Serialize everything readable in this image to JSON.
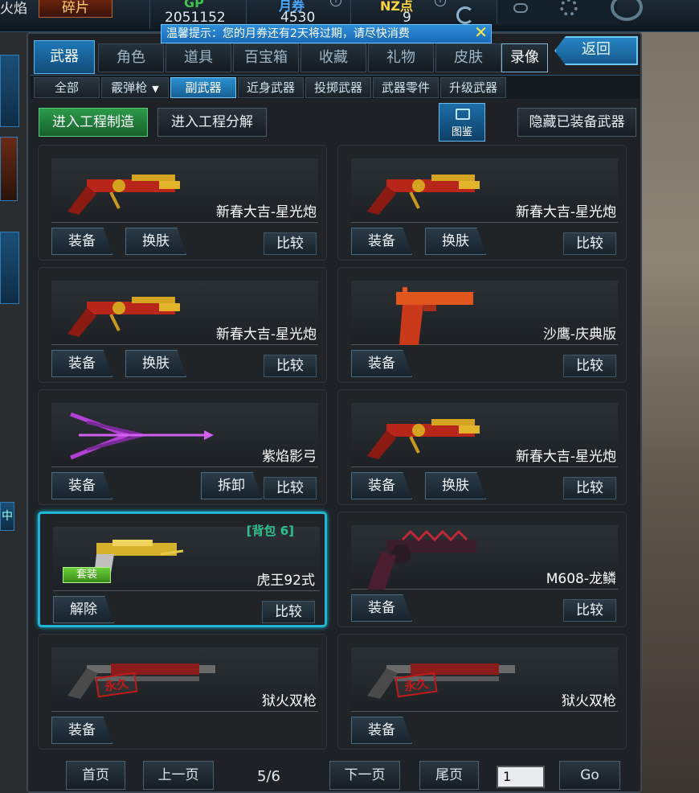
{
  "topbar": {
    "left_text": "火焰",
    "fragment_label": "碎片",
    "gp_label": "GP",
    "gp_value": "2051152",
    "voucher_label": "月券",
    "voucher_value": "4530",
    "nz_label": "NZ点",
    "nz_value": "9"
  },
  "notice": {
    "text": "温馨提示：您的月券还有2天将过期，请尽快消费",
    "close": "✕"
  },
  "tabs": [
    {
      "label": "武器",
      "active": true
    },
    {
      "label": "角色"
    },
    {
      "label": "道具"
    },
    {
      "label": "百宝箱"
    },
    {
      "label": "收藏"
    },
    {
      "label": "礼物"
    },
    {
      "label": "皮肤"
    },
    {
      "label": "录像"
    }
  ],
  "back_label": "返回",
  "subtabs": [
    {
      "label": "全部"
    },
    {
      "label": "霰弹枪",
      "dropdown": true
    },
    {
      "label": "副武器",
      "active": true
    },
    {
      "label": "近身武器"
    },
    {
      "label": "投掷武器"
    },
    {
      "label": "武器零件"
    },
    {
      "label": "升级武器"
    }
  ],
  "actions": {
    "craft": "进入工程制造",
    "disassemble": "进入工程分解",
    "illustrated": "图鉴",
    "hide_equipped": "隐藏已装备武器"
  },
  "items": [
    {
      "name": "新春大吉-星光炮",
      "buttons": [
        "装备",
        "换肤"
      ],
      "compare": "比较",
      "gun": "red-gold-cannon"
    },
    {
      "name": "新春大吉-星光炮",
      "buttons": [
        "装备",
        "换肤"
      ],
      "compare": "比较",
      "gun": "red-gold-cannon"
    },
    {
      "name": "新春大吉-星光炮",
      "buttons": [
        "装备",
        "换肤"
      ],
      "compare": "比较",
      "gun": "red-gold-cannon"
    },
    {
      "name": "沙鹰-庆典版",
      "buttons": [
        "装备"
      ],
      "compare": "比较",
      "gun": "orange-pistol"
    },
    {
      "name": "紫焰影弓",
      "buttons": [
        "装备",
        "拆卸"
      ],
      "compare": "比较",
      "gun": "purple-bow"
    },
    {
      "name": "新春大吉-星光炮",
      "buttons": [
        "装备",
        "换肤"
      ],
      "compare": "比较",
      "gun": "red-gold-cannon"
    },
    {
      "name": "虎王92式",
      "buttons": [
        "解除"
      ],
      "compare": "比较",
      "gun": "gold-pistol",
      "bag_tag": "[背包 6]",
      "set_badge": "套装",
      "selected": true
    },
    {
      "name": "M608-龙鳞",
      "buttons": [
        "装备"
      ],
      "compare": "比较",
      "gun": "dragon-revolver"
    },
    {
      "name": "狱火双枪",
      "buttons": [
        "装备"
      ],
      "gun": "dual-guns",
      "stamp": "永久"
    },
    {
      "name": "狱火双枪",
      "buttons": [
        "装备"
      ],
      "gun": "dual-guns",
      "stamp": "永久"
    }
  ],
  "pagination": {
    "first": "首页",
    "prev": "上一页",
    "page_info": "5/6",
    "next": "下一页",
    "last": "尾页",
    "input_value": "1",
    "go": "Go"
  },
  "side": {
    "left_tag": "中"
  }
}
